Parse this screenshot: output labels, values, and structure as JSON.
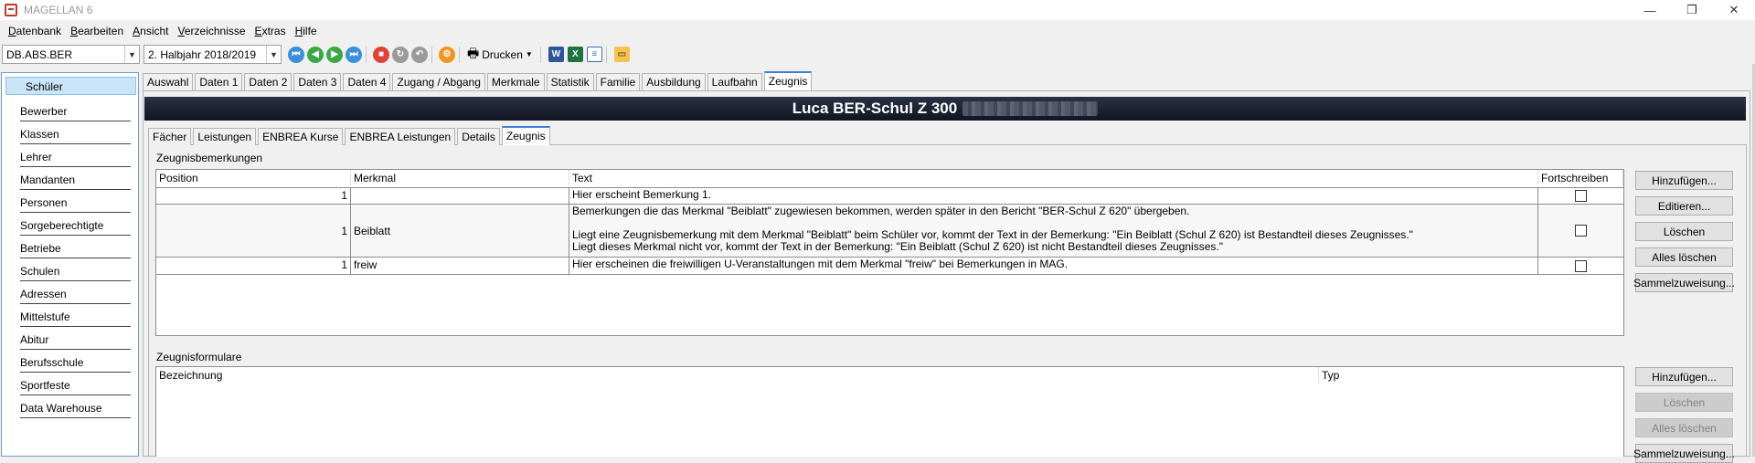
{
  "window": {
    "title": "MAGELLAN 6"
  },
  "menu": [
    {
      "label_u": "D",
      "label_rest": "atenbank"
    },
    {
      "label_u": "B",
      "label_rest": "earbeiten"
    },
    {
      "label_u": "A",
      "label_rest": "nsicht"
    },
    {
      "label_u": "V",
      "label_rest": "erzeichnisse"
    },
    {
      "label_u": "E",
      "label_rest": "xtras"
    },
    {
      "label_u": "H",
      "label_rest": "ilfe"
    }
  ],
  "toolbar": {
    "db_combo": "DB.ABS.BER",
    "period_combo": "2. Halbjahr 2018/2019",
    "print_label": "Drucken",
    "colors": {
      "blue": "#3b8fd9",
      "green": "#3aa845",
      "red": "#e0413a",
      "gray": "#9a9a9a",
      "orange": "#f0961e"
    }
  },
  "sidebar": {
    "items": [
      "Schüler",
      "Bewerber",
      "Klassen",
      "Lehrer",
      "Mandanten",
      "Personen",
      "Sorgeberechtigte",
      "Betriebe",
      "Schulen",
      "Adressen",
      "Mittelstufe",
      "Abitur",
      "Berufsschule",
      "Sportfeste",
      "Data Warehouse"
    ]
  },
  "main_tabs": [
    "Auswahl",
    "Daten 1",
    "Daten 2",
    "Daten 3",
    "Daten 4",
    "Zugang / Abgang",
    "Merkmale",
    "Statistik",
    "Familie",
    "Ausbildung",
    "Laufbahn",
    "Zeugnis"
  ],
  "banner": {
    "student_name": "Luca BER-Schul Z 300"
  },
  "sub_tabs": [
    "Fächer",
    "Leistungen",
    "ENBREA Kurse",
    "ENBREA Leistungen",
    "Details",
    "Zeugnis"
  ],
  "remarks": {
    "title": "Zeugnisbemerkungen",
    "columns": [
      "Position",
      "Merkmal",
      "Text",
      "Fortschreiben"
    ],
    "rows": [
      {
        "position": "1",
        "merkmal": "",
        "text": [
          "Hier erscheint Bemerkung 1."
        ],
        "fortschreiben": false
      },
      {
        "position": "1",
        "merkmal": "Beiblatt",
        "text": [
          "Bemerkungen die das Merkmal \"Beiblatt\" zugewiesen bekommen, werden später in den Bericht \"BER-Schul Z 620\" übergeben.",
          "",
          "Liegt eine Zeugnisbemerkung mit dem Merkmal \"Beiblatt\" beim Schüler vor, kommt der Text in der Bemerkung: \"Ein Beiblatt (Schul Z 620) ist Bestandteil dieses Zeugnisses.\"",
          "Liegt dieses Merkmal nicht vor, kommt der Text in der Bemerkung: \"Ein Beiblatt (Schul Z 620) ist nicht Bestandteil dieses Zeugnisses.\""
        ],
        "fortschreiben": false
      },
      {
        "position": "1",
        "merkmal": "freiw",
        "text": [
          "Hier erscheinen die freiwilligen U-Veranstaltungen mit dem Merkmal \"freiw\" bei Bemerkungen in MAG."
        ],
        "fortschreiben": false
      }
    ],
    "buttons": [
      "Hinzufügen...",
      "Editieren...",
      "Löschen",
      "Alles löschen",
      "Sammelzuweisung..."
    ]
  },
  "forms": {
    "title": "Zeugnisformulare",
    "columns": [
      "Bezeichnung",
      "Typ"
    ],
    "buttons": [
      "Hinzufügen...",
      "Löschen",
      "Alles löschen",
      "Sammelzuweisung..."
    ]
  }
}
